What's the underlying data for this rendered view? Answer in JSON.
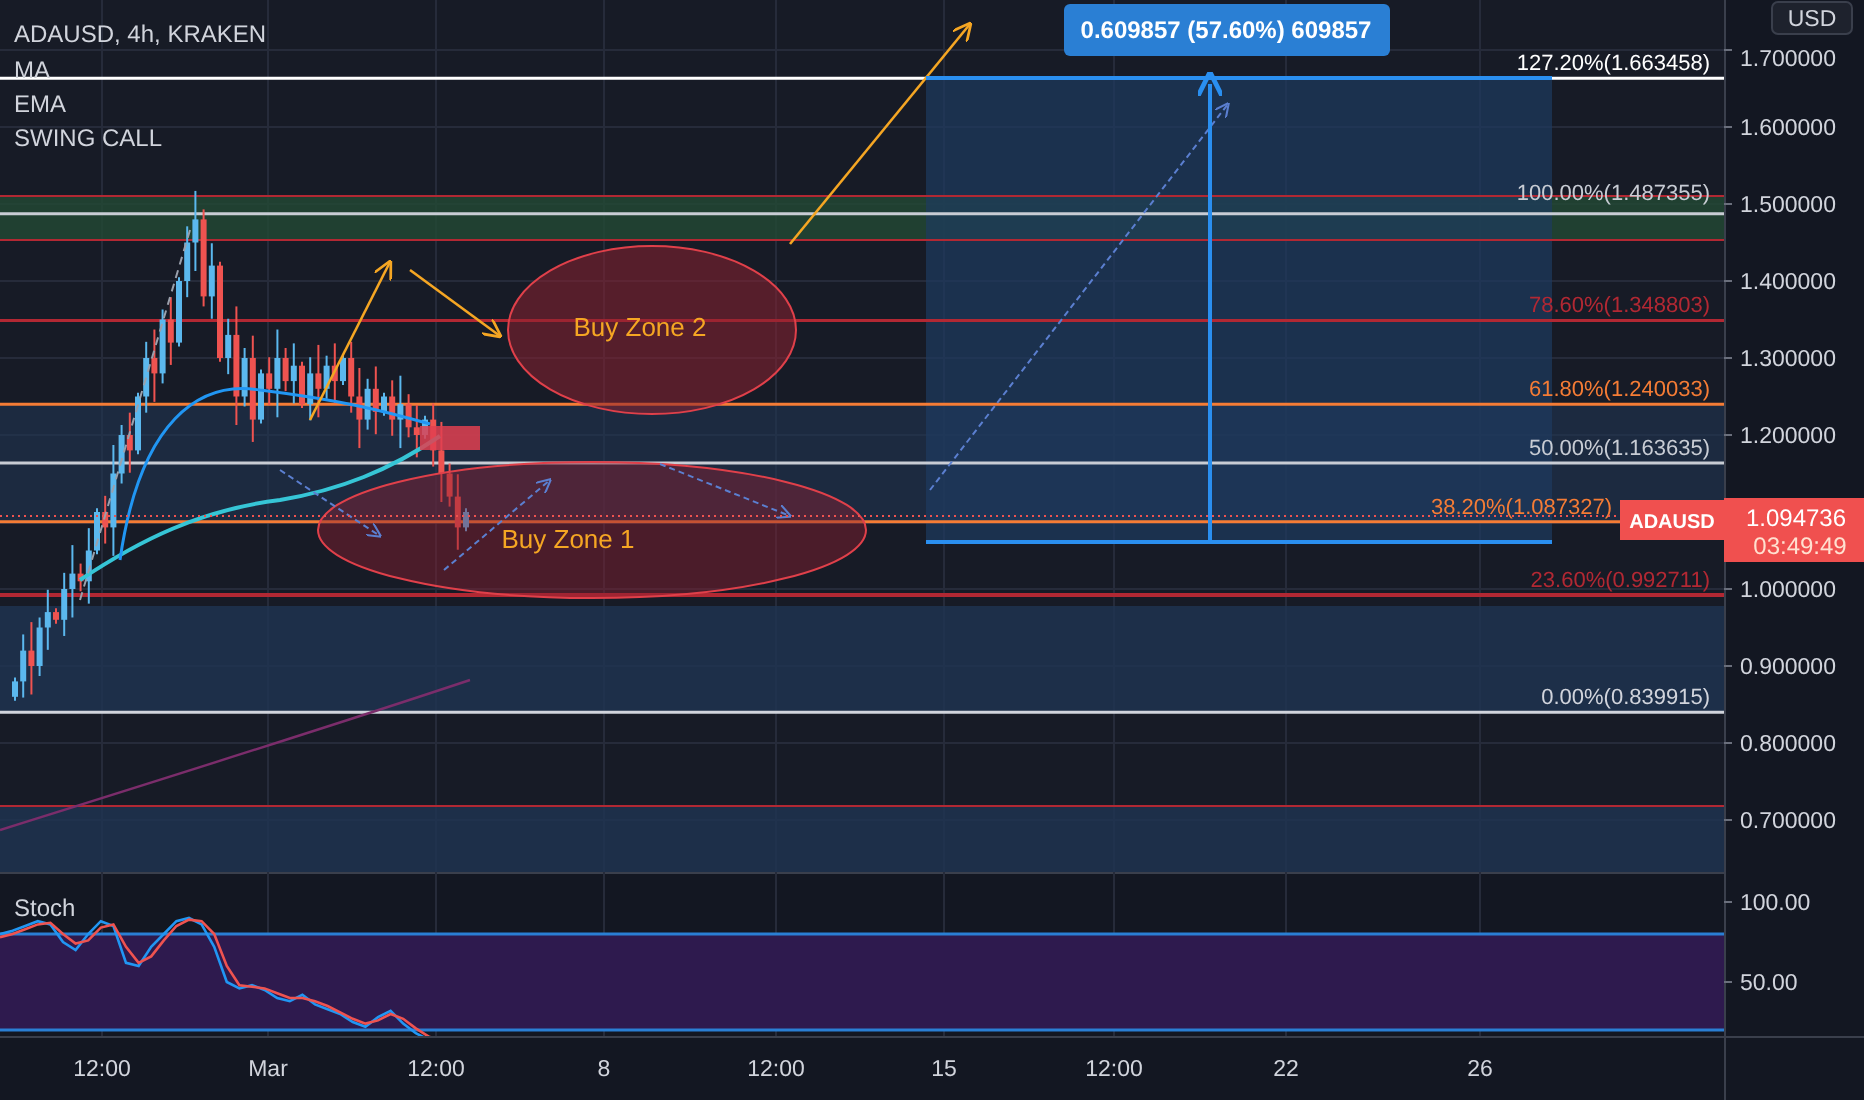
{
  "legend": {
    "symbol_line": "ADAUSD, 4h, KRAKEN",
    "indicators": [
      "MA",
      "EMA",
      "SWING CALL"
    ]
  },
  "measure": {
    "label": "0.609857 (57.60%) 609857"
  },
  "fib_levels": [
    {
      "label": "127.20%(1.663458)",
      "color": "#ffffff"
    },
    {
      "label": "100.00%(1.487355)",
      "color": "#c8ccd4"
    },
    {
      "label": "78.60%(1.348803)",
      "color": "#b22833"
    },
    {
      "label": "61.80%(1.240033)",
      "color": "#f57c35"
    },
    {
      "label": "50.00%(1.163635)",
      "color": "#c8ccd4"
    },
    {
      "label": "38.20%(1.087327)",
      "color": "#f57c35"
    },
    {
      "label": "23.60%(0.992711)",
      "color": "#b22833"
    },
    {
      "label": "0.00%(0.839915)",
      "color": "#d1d4dc"
    }
  ],
  "zones": [
    {
      "label": "Buy Zone 2"
    },
    {
      "label": "Buy Zone 1"
    }
  ],
  "price_axis": {
    "currency": "USD",
    "ticks": [
      "1.700000",
      "1.600000",
      "1.500000",
      "1.400000",
      "1.300000",
      "1.200000",
      "1.000000",
      "0.900000",
      "0.800000",
      "0.700000"
    ]
  },
  "last_price": {
    "symbol": "ADAUSD",
    "price": "1.094736",
    "countdown": "03:49:49"
  },
  "stoch": {
    "title": "Stoch",
    "ticks": [
      "100.00",
      "50.00"
    ]
  },
  "time_axis": [
    "12:00",
    "Mar",
    "12:00",
    "8",
    "12:00",
    "15",
    "12:00",
    "22",
    "26"
  ]
}
